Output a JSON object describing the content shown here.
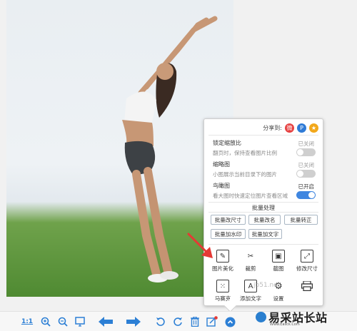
{
  "share": {
    "label": "分享到:",
    "icons": [
      "weibo-icon",
      "p-icon",
      "star-icon"
    ]
  },
  "options": [
    {
      "title": "锁定缩放比",
      "state": "已关闭",
      "desc": "翻页时，保持查看图片比例",
      "enabled": false
    },
    {
      "title": "缩略图",
      "state": "已关闭",
      "desc": "小图展示当前目录下的图片",
      "enabled": false
    },
    {
      "title": "鸟瞰图",
      "state": "已开启",
      "desc": "看大图时快速定位图片查看区域",
      "enabled": true
    }
  ],
  "batch": {
    "title": "批量处理",
    "buttons": [
      "批量改尺寸",
      "批量改名",
      "批量转正",
      "批量加水印",
      "批量加文字"
    ]
  },
  "tools": [
    {
      "label": "图片美化",
      "icon": "pencil-icon"
    },
    {
      "label": "裁剪",
      "icon": "crop-icon"
    },
    {
      "label": "截图",
      "icon": "screenshot-icon"
    },
    {
      "label": "修改尺寸",
      "icon": "resize-icon"
    },
    {
      "label": "马赛克",
      "icon": "mosaic-icon"
    },
    {
      "label": "添加文字",
      "icon": "text-icon"
    },
    {
      "label": "设置",
      "icon": "gear-icon"
    },
    {
      "label": "",
      "icon": "printer-icon"
    }
  ],
  "toolbar": {
    "actual_size": "1:1",
    "items": [
      "actual-size-icon",
      "zoom-in-icon",
      "zoom-out-icon",
      "fit-screen-icon",
      "prev-arrow-icon",
      "next-arrow-icon",
      "rotate-left-icon",
      "rotate-right-icon",
      "delete-icon",
      "edit-icon",
      "more-chevron-icon"
    ]
  },
  "watermark": {
    "url": "jb51.net",
    "brand": "易采站长站",
    "sub": "Www.Easck.Com"
  },
  "colors": {
    "accent": "#2c7fd5",
    "toggle_on": "#3f86e0",
    "annotation": "#e53935"
  }
}
